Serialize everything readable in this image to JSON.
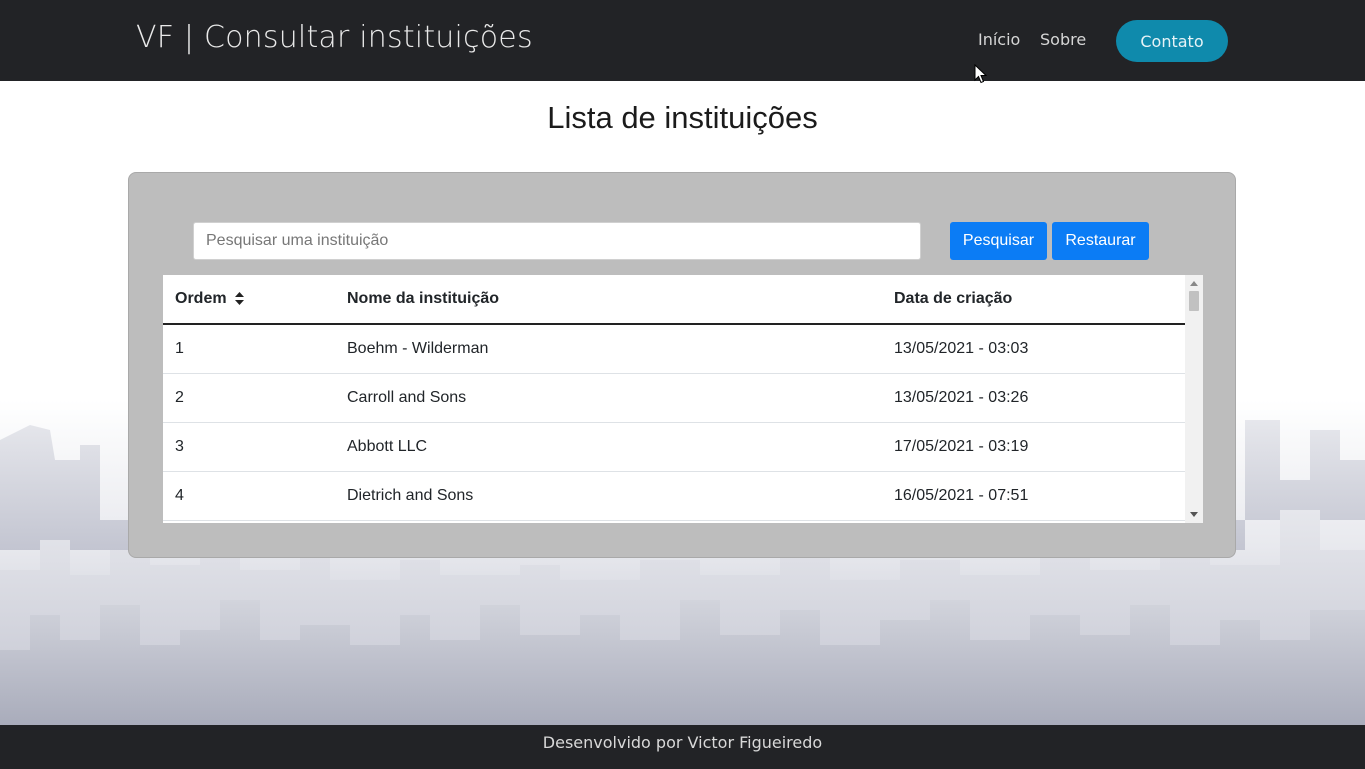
{
  "navbar": {
    "brand": "VF | Consultar instituições",
    "links": [
      {
        "label": "Início"
      },
      {
        "label": "Sobre"
      }
    ],
    "contact_label": "Contato"
  },
  "main": {
    "title": "Lista de instituições",
    "search": {
      "placeholder": "Pesquisar uma instituição",
      "value": ""
    },
    "buttons": {
      "search_label": "Pesquisar",
      "reset_label": "Restaurar"
    },
    "table": {
      "headers": {
        "order": "Ordem",
        "name": "Nome da instituição",
        "created": "Data de criação"
      },
      "rows": [
        {
          "order": "1",
          "name": "Boehm - Wilderman",
          "created": "13/05/2021 - 03:03"
        },
        {
          "order": "2",
          "name": "Carroll and Sons",
          "created": "13/05/2021 - 03:26"
        },
        {
          "order": "3",
          "name": "Abbott LLC",
          "created": "17/05/2021 - 03:19"
        },
        {
          "order": "4",
          "name": "Dietrich and Sons",
          "created": "16/05/2021 - 07:51"
        }
      ]
    }
  },
  "footer": {
    "text": "Desenvolvido por Victor Figueiredo"
  },
  "colors": {
    "navbar_bg": "#222326",
    "contact_button": "#0f8aac",
    "primary_button": "#0b7cf5",
    "panel_bg": "#bdbdbd"
  },
  "icons": {
    "sort": "sort-icon",
    "pointer": "cursor-icon"
  }
}
